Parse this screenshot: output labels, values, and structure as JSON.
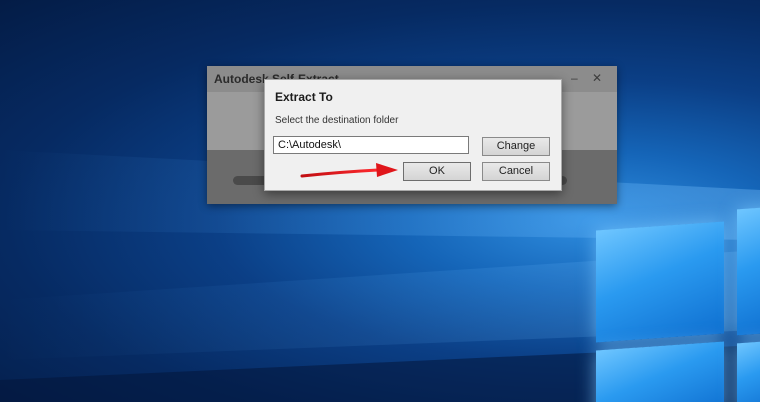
{
  "background_window": {
    "title": "Autodesk Self-Extract",
    "minimize_glyph": "–",
    "close_glyph": "✕"
  },
  "dialog": {
    "title": "Extract To",
    "subtitle": "Select the destination folder",
    "path_value": "C:\\Autodesk\\",
    "change_label": "Change",
    "ok_label": "OK",
    "cancel_label": "Cancel"
  },
  "annotation": {
    "arrow_color": "#e0161b"
  }
}
